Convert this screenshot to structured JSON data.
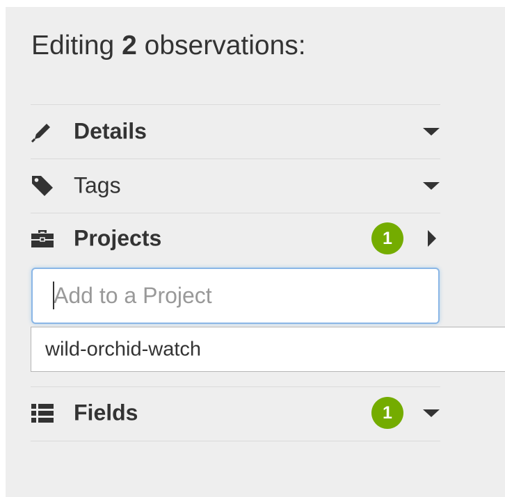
{
  "header": {
    "prefix": "Editing",
    "count": "2",
    "suffix": "observations:"
  },
  "sections": {
    "details": {
      "label": "Details",
      "icon": "pencil-icon",
      "caret": "chevron-down-icon"
    },
    "tags": {
      "label": "Tags",
      "icon": "tag-icon",
      "caret": "chevron-down-icon"
    },
    "projects": {
      "label": "Projects",
      "icon": "briefcase-icon",
      "badge": "1",
      "caret": "chevron-right-icon",
      "expanded": true
    },
    "fields": {
      "label": "Fields",
      "icon": "list-icon",
      "badge": "1",
      "caret": "chevron-down-icon"
    }
  },
  "project_search": {
    "placeholder": "Add to a Project",
    "value": ""
  },
  "suggestions": [
    {
      "label": "wild-orchid-watch"
    }
  ],
  "colors": {
    "badge": "#74ac00",
    "panel": "#eeeeee",
    "focus_border": "#8ab6e6"
  }
}
